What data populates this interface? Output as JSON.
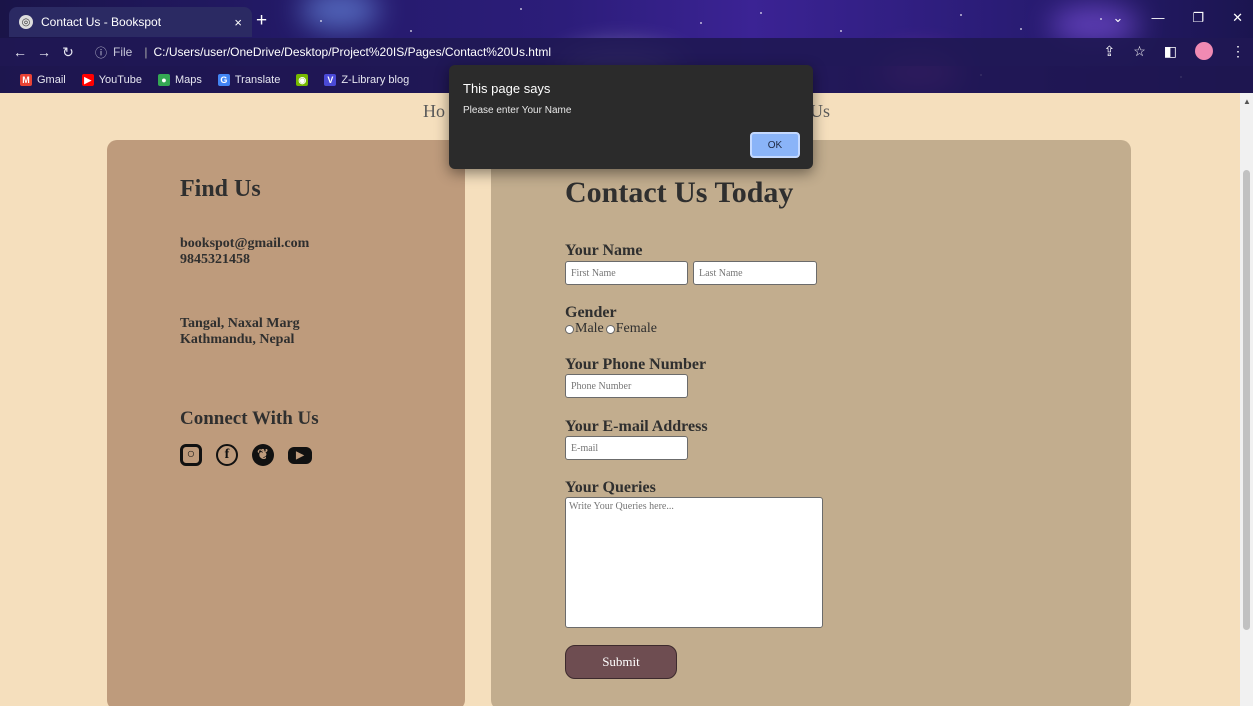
{
  "browser": {
    "tab_title": "Contact Us - Bookspot",
    "tab_close": "×",
    "new_tab": "+",
    "address_info": "File",
    "address_url": "C:/Users/user/OneDrive/Desktop/Project%20IS/Pages/Contact%20Us.html",
    "bookmarks": [
      {
        "label": "Gmail",
        "icon": "gmail-icon",
        "color": "#ea4335"
      },
      {
        "label": "YouTube",
        "icon": "youtube-icon",
        "color": "#ff0000"
      },
      {
        "label": "Maps",
        "icon": "maps-icon",
        "color": "#34a853"
      },
      {
        "label": "Translate",
        "icon": "translate-icon",
        "color": "#4285f4"
      },
      {
        "label": "",
        "icon": "nvidia-icon",
        "color": "#76b900"
      },
      {
        "label": "Z-Library blog",
        "icon": "zlibrary-icon",
        "color": "#4a4ad6"
      }
    ]
  },
  "nav": {
    "home": "Ho",
    "about": "Us"
  },
  "find_us": {
    "title": "Find Us",
    "email": "bookspot@gmail.com",
    "phone": "9845321458",
    "address_line1": "Tangal, Naxal Marg",
    "address_line2": "Kathmandu, Nepal",
    "connect_title": "Connect With Us",
    "socials": [
      "instagram-icon",
      "facebook-icon",
      "twitter-icon",
      "youtube-icon"
    ]
  },
  "contact": {
    "title": "Contact Us Today",
    "name_label": "Your Name",
    "first_placeholder": "First Name",
    "last_placeholder": "Last Name",
    "gender_label": "Gender",
    "male": "Male",
    "female": "Female",
    "phone_label": "Your Phone Number",
    "phone_placeholder": "Phone Number",
    "email_label": "Your E-mail Address",
    "email_placeholder": "E-mail",
    "queries_label": "Your Queries",
    "queries_placeholder": "Write Your Queries here...",
    "submit": "Submit"
  },
  "dialog": {
    "title": "This page says",
    "message": "Please enter Your Name",
    "ok": "OK"
  },
  "colors": {
    "page_bg": "#f5dfbd",
    "find_panel": "#be9b7c",
    "contact_panel": "#c2ad8e",
    "submit_button": "#6e4d51",
    "dialog_ok": "#8ab4f8"
  }
}
